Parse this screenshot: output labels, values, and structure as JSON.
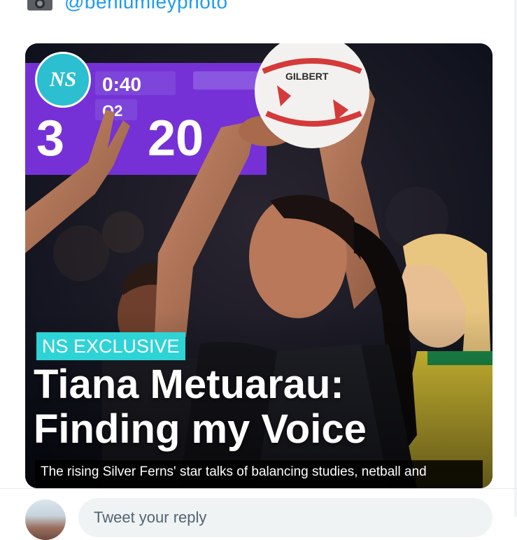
{
  "credit": {
    "icon": "camera-icon",
    "handle": "@benlumleyphoto"
  },
  "card": {
    "logo_text": "NS",
    "scoreboard": {
      "time": "0:40",
      "period": "Q2",
      "home_score": "3",
      "away_score": "20"
    },
    "badge": "NS EXCLUSIVE",
    "headline_line1": "Tiana Metuarau:",
    "headline_line2": "Finding my Voice",
    "subline": "The rising Silver Ferns' star talks of balancing studies, netball and",
    "ball_text": "GILBERT"
  },
  "reply": {
    "placeholder": "Tweet your reply"
  },
  "colors": {
    "accent": "#1d9bf0",
    "badge_bg": "#2ed3d6",
    "logo_bg": "#2bbfd0",
    "scoreboard_bg": "#6a27c9"
  }
}
